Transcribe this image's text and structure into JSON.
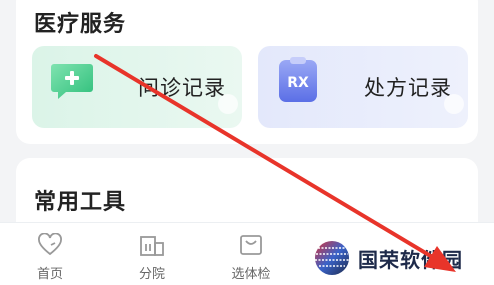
{
  "medical_services": {
    "title": "医疗服务",
    "tiles": [
      {
        "label": "问诊记录",
        "icon": "chat-plus-icon",
        "color": "#3ecf8e"
      },
      {
        "label": "处方记录",
        "icon": "rx-icon",
        "color": "#6f83ee",
        "icon_text": "RX"
      }
    ]
  },
  "tools": {
    "title": "常用工具"
  },
  "tabbar": {
    "items": [
      {
        "label": "首页",
        "icon": "heart-icon"
      },
      {
        "label": "分院",
        "icon": "building-icon"
      },
      {
        "label": "选体检",
        "icon": "bag-icon"
      }
    ]
  },
  "watermark": {
    "text": "国荣软件园"
  },
  "colors": {
    "arrow": "#e8342a",
    "accent_green": "#3ecf8e",
    "accent_blue": "#6f83ee"
  }
}
